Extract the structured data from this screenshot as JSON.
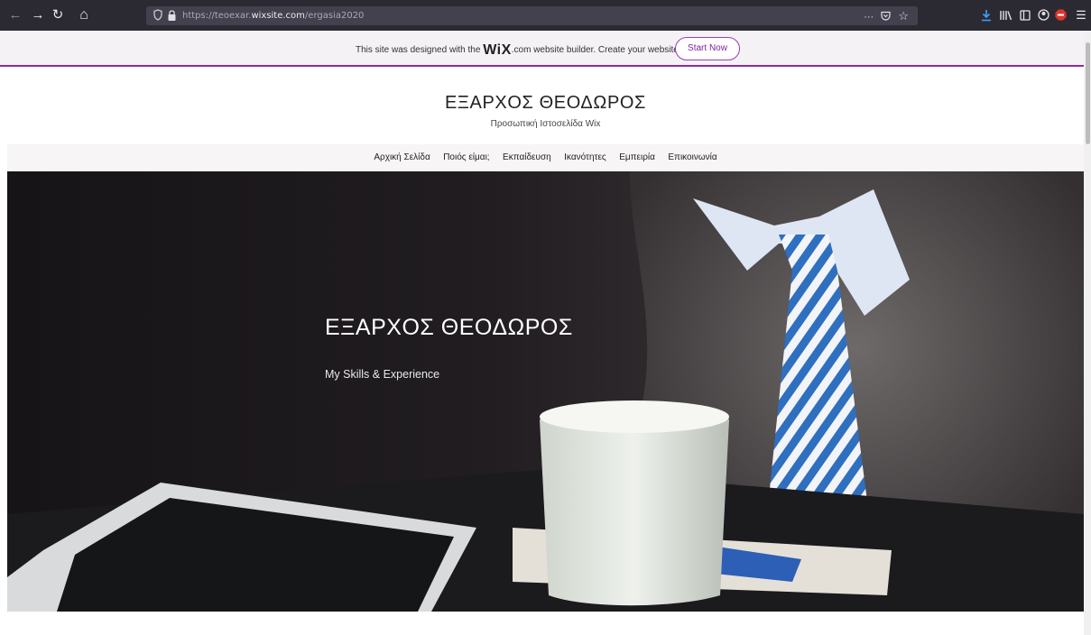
{
  "browser": {
    "url_prefix": "https://teoexar.",
    "url_domain": "wixsite.com",
    "url_path": "/ergasia2020",
    "back_glyph": "←",
    "forward_glyph": "→",
    "reload_glyph": "↻",
    "home_glyph": "⌂",
    "more_glyph": "···",
    "star_glyph": "☆",
    "menu_glyph": "☰",
    "icons": [
      "back-icon",
      "forward-icon",
      "reload-icon",
      "home-icon",
      "shield-icon",
      "lock-icon",
      "more-icon",
      "pocket-icon",
      "star-icon",
      "download-icon",
      "library-icon",
      "sidebar-icon",
      "account-icon",
      "adblock-icon",
      "menu-icon"
    ]
  },
  "wix_banner": {
    "message_before": "This site was designed with the",
    "logo": "WiX",
    "message_after": ".com website builder. Create your website today.",
    "button_label": "Start Now",
    "accent_color": "#8a2da3"
  },
  "site": {
    "title": "ΕΞΑΡΧΟΣ ΘΕΟΔΩΡΟΣ",
    "subtitle": "Προσωπική Ιστοσελίδα Wix"
  },
  "nav": {
    "items": [
      "Αρχική Σελίδα",
      "Ποιός είμαι;",
      "Εκπαίδευση",
      "Ικανότητες",
      "Εμπειρία",
      "Επικοινωνία"
    ]
  },
  "hero": {
    "title": "ΕΞΑΡΧΟΣ ΘΕΟΔΩΡΟΣ",
    "subtitle": "My Skills & Experience"
  }
}
